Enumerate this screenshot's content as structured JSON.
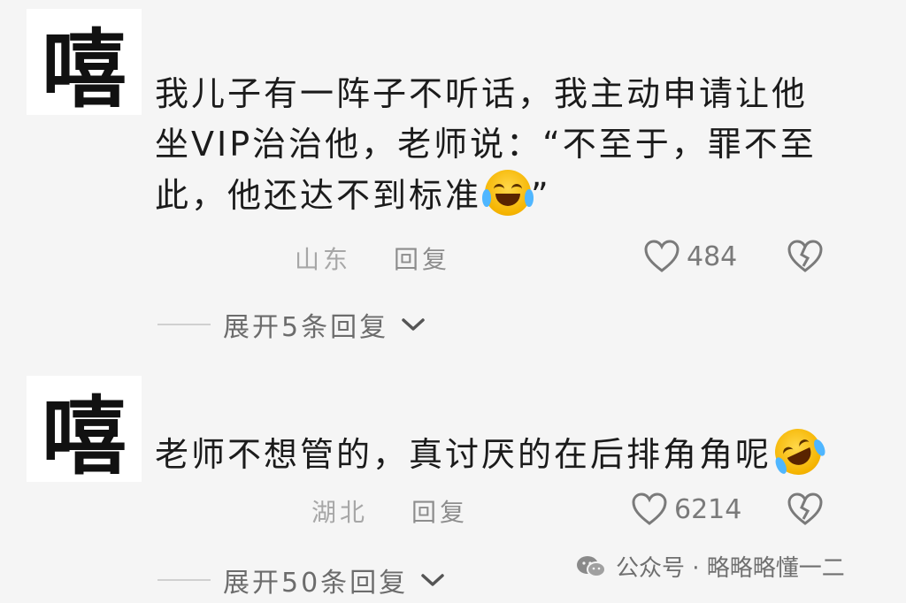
{
  "comments": [
    {
      "avatar_glyph": "嘻",
      "text": "我儿子有一阵子不听话，我主动申请让他坐VIP治治他，老师说：“不至于，罪不至此，他还达不到标准",
      "text_tail": "”",
      "emoji": "laugh-crying-emoji",
      "region": "山东",
      "reply_label": "回复",
      "likes": "484",
      "expand_label": "展开5条回复"
    },
    {
      "avatar_glyph": "嘻",
      "text": "老师不想管的，真讨厌的在后排角角呢",
      "text_tail": "",
      "emoji": "rolling-laugh-emoji",
      "region": "湖北",
      "reply_label": "回复",
      "likes": "6214",
      "expand_label": "展开50条回复"
    }
  ],
  "watermark": {
    "icon": "wechat-icon",
    "text": "公众号 · 略略略懂一二"
  },
  "colors": {
    "background": "#f5f5f5",
    "text": "#1b1b1b",
    "meta": "#a7a7a7",
    "emoji": "#f5b400"
  }
}
